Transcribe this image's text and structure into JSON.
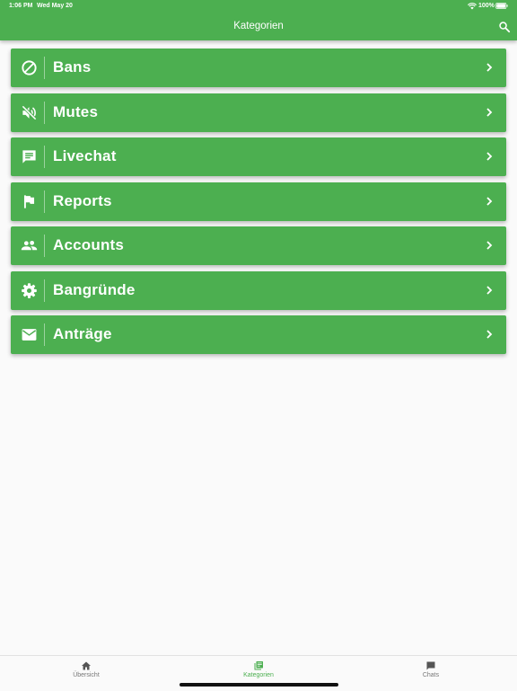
{
  "status_bar": {
    "time": "1:06 PM",
    "date": "Wed May 20",
    "battery": "100%"
  },
  "appbar": {
    "title": "Kategorien"
  },
  "categories": [
    {
      "label": "Bans",
      "icon": "block-icon"
    },
    {
      "label": "Mutes",
      "icon": "volume-off-icon"
    },
    {
      "label": "Livechat",
      "icon": "chat-message-icon"
    },
    {
      "label": "Reports",
      "icon": "flag-icon"
    },
    {
      "label": "Accounts",
      "icon": "people-icon"
    },
    {
      "label": "Bangründe",
      "icon": "gear-icon"
    },
    {
      "label": "Anträge",
      "icon": "mail-icon"
    }
  ],
  "tabs": [
    {
      "label": "Übersicht",
      "icon": "home-icon",
      "active": false
    },
    {
      "label": "Kategorien",
      "icon": "library-books-icon",
      "active": true
    },
    {
      "label": "Chats",
      "icon": "chat-icon",
      "active": false
    }
  ],
  "colors": {
    "primary": "#4caf50",
    "background": "#fafafa",
    "inactive_tab": "#777777"
  }
}
